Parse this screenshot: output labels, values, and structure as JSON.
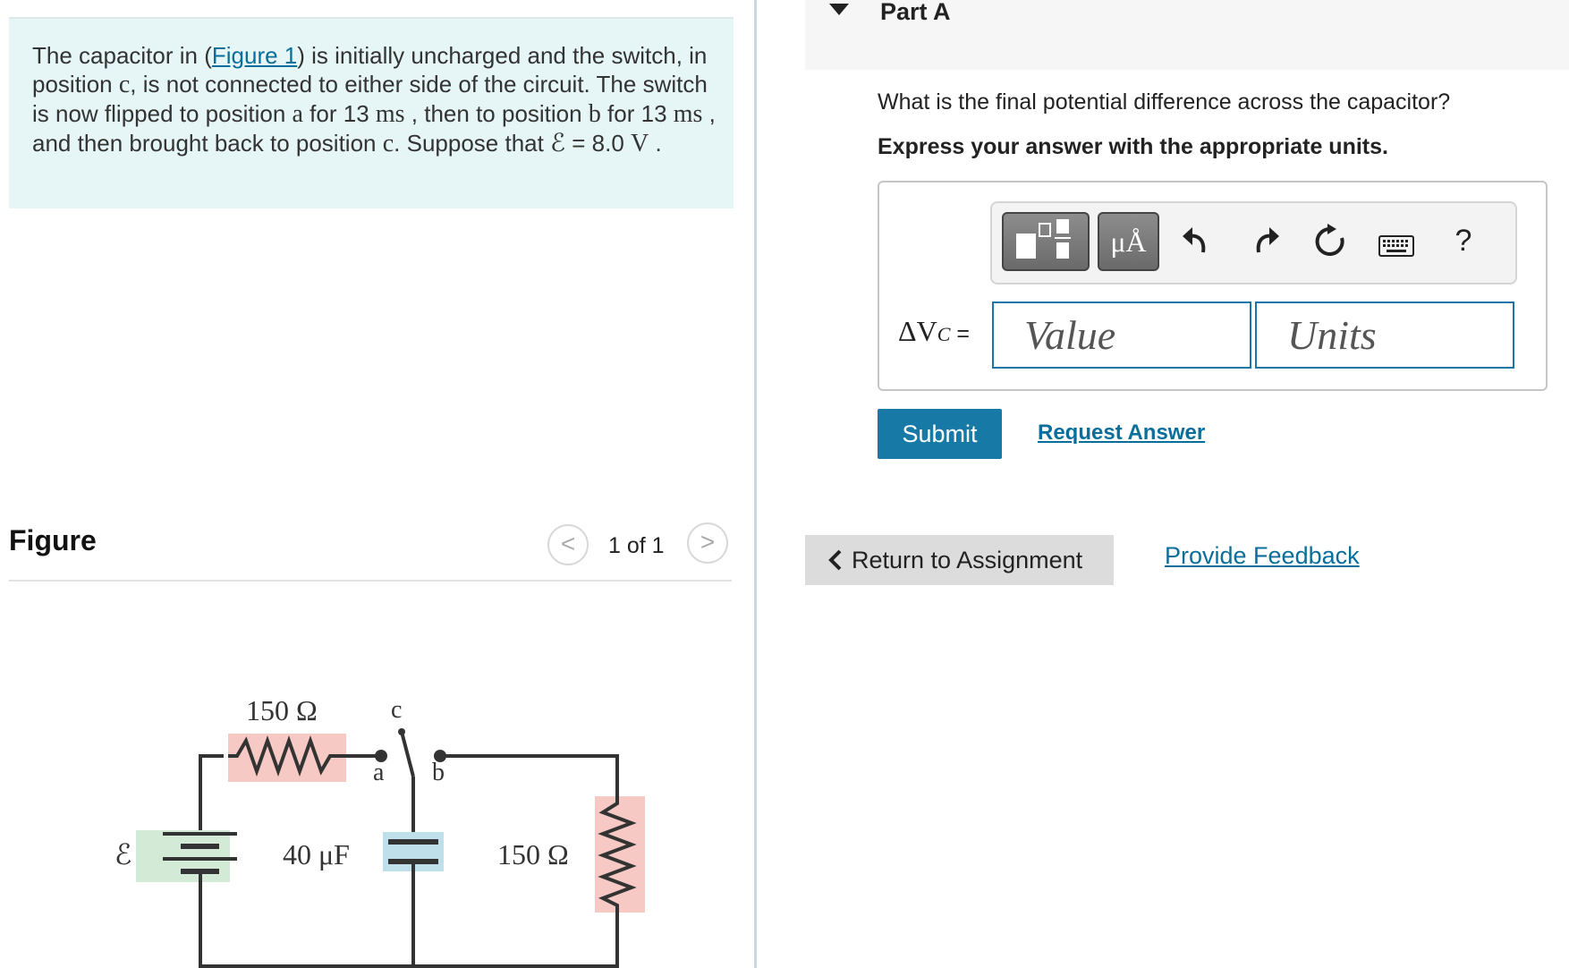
{
  "problem": {
    "t1": "The capacitor in (",
    "figure_link": "Figure 1",
    "t2": ") is initially uncharged and the switch, in position ",
    "pos_c": "c",
    "t3": ", is not connected to either side of the circuit. The switch is now flipped to position ",
    "pos_a": "a",
    "t4": " for 13 ",
    "ms1": "ms",
    "t5": " , then to position ",
    "pos_b": "b",
    "t6": " for 13 ",
    "ms2": "ms",
    "t7": " , and then brought back to position ",
    "pos_c2": "c",
    "t8": ". Suppose that ",
    "emf_symbol": "ℰ",
    "t9": " = 8.0 ",
    "volt_unit": "V",
    "t10": " ."
  },
  "figure": {
    "title": "Figure",
    "prev_icon": "chevron-left-icon",
    "next_icon": "chevron-right-icon",
    "prev_glyph": "<",
    "next_glyph": ">",
    "counter": "1 of 1",
    "circuit": {
      "r1": "150 Ω",
      "r2": "150 Ω",
      "cap": "40 μF",
      "emf": "ℰ",
      "pos_a": "a",
      "pos_b": "b",
      "pos_c": "c"
    }
  },
  "part": {
    "label": "Part A",
    "question": "What is the final potential difference across the capacitor?",
    "instruction": "Express your answer with the appropriate units."
  },
  "toolbar": {
    "units_btn": "μÅ",
    "help": "?",
    "icons": [
      "templates-icon",
      "units-icon",
      "undo-icon",
      "redo-icon",
      "reset-icon",
      "keyboard-icon",
      "help-icon"
    ]
  },
  "answer": {
    "label_prefix": "ΔV",
    "label_sub": "C",
    "label_suffix": " =",
    "value_placeholder": "Value",
    "units_placeholder": "Units"
  },
  "actions": {
    "submit": "Submit",
    "request_answer": "Request Answer",
    "return": "Return to Assignment",
    "feedback": "Provide Feedback"
  },
  "colors": {
    "problem_bg": "#e6f5f5",
    "accent": "#1779a6",
    "link": "#0a6e9b",
    "resistor_fill": "#f6c9c4",
    "battery_fill": "#d3ead6",
    "capacitor_fill": "#bfe0ea"
  }
}
